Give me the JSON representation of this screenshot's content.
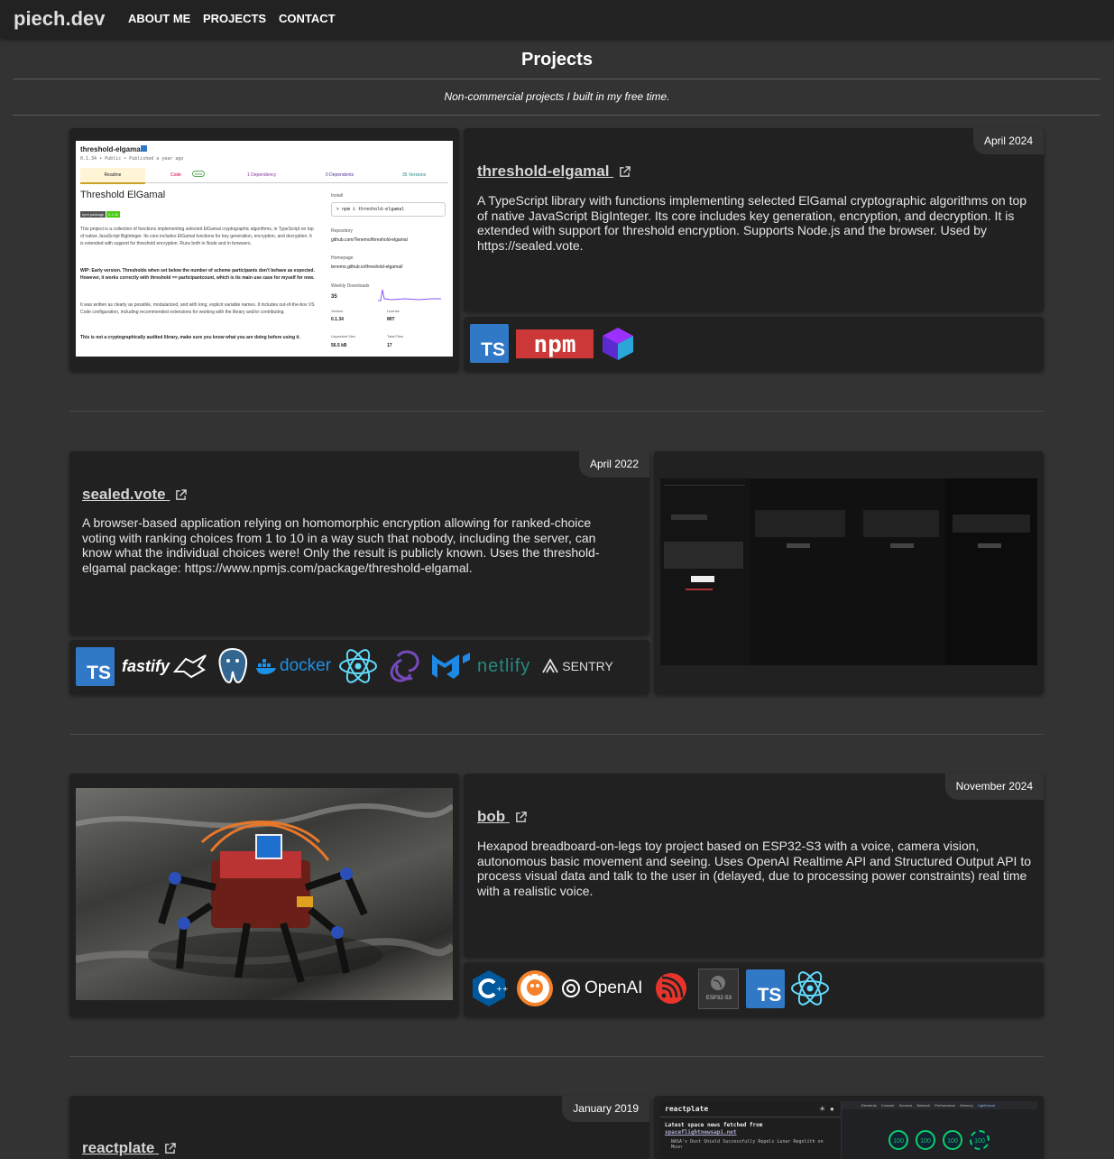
{
  "nav": {
    "brand": "piech.dev",
    "links": [
      "ABOUT ME",
      "PROJECTS",
      "CONTACT"
    ]
  },
  "page": {
    "title": "Projects",
    "subtitle": "Non-commercial projects I built in my free time."
  },
  "projects": [
    {
      "name": "threshold-elgamal",
      "date": "April 2024",
      "description": "A TypeScript library with functions implementing selected ElGamal cryptographic algorithms on top of native JavaScript BigInteger. Its core includes key generation, encryption, and decryption. It is extended with support for threshold encryption. Supports Node.js and the browser. Used by https://sealed.vote.",
      "tech": [
        "typescript-icon",
        "npm-icon",
        "vite-cube-icon"
      ],
      "screenshot": {
        "pkg": "threshold-elgamal",
        "meta": "0.1.34 • Public • Published a year ago",
        "tabs": [
          "Readme",
          "Code",
          "1 Dependency",
          "0 Dependents",
          "35 Versions"
        ],
        "beta": "Beta",
        "heading": "Threshold ElGamal",
        "badge1": "npm package",
        "badge2": "0.1.34",
        "p1": "This project is a collection of functions implementing selected ElGamal cryptographic algorithms, in TypeScript on top of native JavaScript BigInteger. Its core includes ElGamal functions for key generation, encryption, and decryption. It is extended with support for threshold encryption. Runs both in Node and in browsers.",
        "p2": "WIP: Early version. Thresholds when set below the number of scheme participants don't behave as expected. However, it works correctly with threshold == participantcount, which is its main use case for myself for now.",
        "p3": "It was written as clearly as possible, modularized, and with long, explicit variable names. It includes out-of-the-box VS Code configuration, including recommended extensions for working with the library and/or contributing.",
        "p4": "This is not a cryptographically audited library, make sure you know what you are doing before using it.",
        "install_label": "Install",
        "install_cmd": "> npm i threshold-elgamal",
        "repo_label": "Repository",
        "repo": "github.com/Tenemo/threshold-elgamal",
        "home_label": "Homepage",
        "home": "tenemo.github.io/threshold-elgamal/",
        "dl_label": "Weekly Downloads",
        "dl": "35",
        "version_label": "Version",
        "version": "0.1.34",
        "license_label": "License",
        "license": "MIT",
        "size_label": "Unpacked Size",
        "size": "56.5 kB",
        "files_label": "Total Files",
        "files": "17"
      }
    },
    {
      "name": "sealed.vote",
      "date": "April 2022",
      "description": "A browser-based application relying on homomorphic encryption allowing for ranked-choice voting with ranking choices from 1 to 10 in a way such that nobody, including the server, can know what the individual choices were! Only the result is publicly known. Uses the threshold-elgamal package: https://www.npmjs.com/package/threshold-elgamal.",
      "tech": [
        "typescript-icon",
        "fastify-icon",
        "nestjs-icon",
        "postgresql-icon",
        "docker-icon",
        "react-icon",
        "redux-icon",
        "mui-icon",
        "netlify-icon",
        "sentry-icon"
      ],
      "tech_text": {
        "fastify": "fastify",
        "docker": "docker",
        "netlify": "netlify",
        "sentry": "SENTRY"
      }
    },
    {
      "name": "bob",
      "date": "November 2024",
      "description": "Hexapod breadboard-on-legs toy project based on ESP32-S3 with a voice, camera vision, autonomous basic movement and seeing. Uses OpenAI Realtime API and Structured Output API to process visual data and talk to the user in (delayed, due to processing power constraints) real time with a realistic voice.",
      "tech": [
        "cpp-icon",
        "platformio-icon",
        "openai-icon",
        "espressif-icon",
        "esp32-s3-chip-icon",
        "typescript-icon",
        "react-icon"
      ],
      "tech_text": {
        "openai": "OpenAI",
        "esp": "ESP32-S3"
      }
    },
    {
      "name": "reactplate",
      "date": "January 2019",
      "screenshot": {
        "app_title": "reactplate",
        "news_heading": "Latest space news fetched from",
        "news_source": "spaceflightnewsapi.net",
        "news_item": "NASA's Dust Shield Successfully Repels Lunar Regolith on Moon",
        "scores": [
          "100",
          "100",
          "100",
          "100"
        ],
        "devtools_tabs": [
          "Elements",
          "Console",
          "Sources",
          "Network",
          "Performance",
          "Memory",
          "Lighthouse"
        ]
      }
    }
  ],
  "colors": {
    "background": "#333333",
    "nav": "#222222",
    "card": "#212121",
    "typescript": "#3178c6",
    "npm": "#cb3837"
  }
}
